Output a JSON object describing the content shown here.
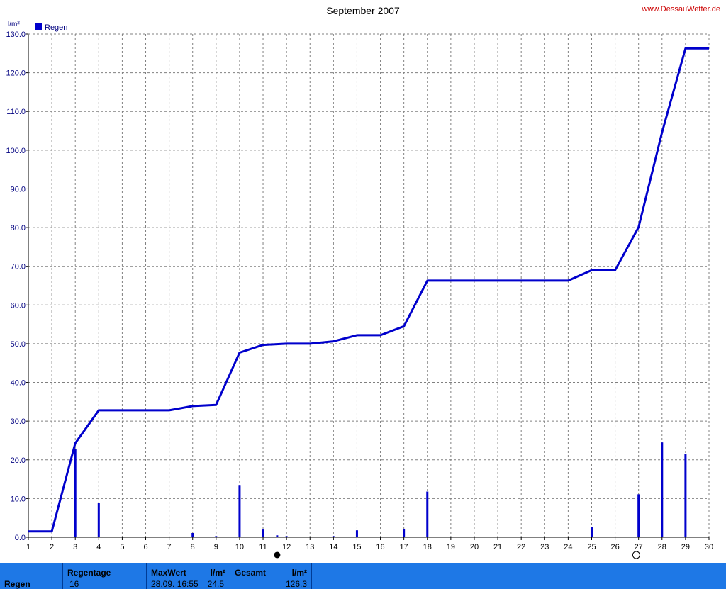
{
  "header": {
    "title": "September 2007",
    "source": "www.DessauWetter.de",
    "unit": "l/m²"
  },
  "legend": {
    "label": "Regen",
    "color": "#0000cc"
  },
  "moon_markers": [
    {
      "day": 11.6,
      "phase": "new-moon"
    },
    {
      "day": 26.9,
      "phase": "full-moon"
    }
  ],
  "chart_data": {
    "type": "bar+line",
    "title": "September 2007",
    "ylabel": "l/m²",
    "xlim": [
      1,
      30
    ],
    "ylim": [
      0,
      130
    ],
    "yticks": [
      "0.0",
      "10.0",
      "20.0",
      "30.0",
      "40.0",
      "50.0",
      "60.0",
      "70.0",
      "80.0",
      "90.0",
      "100.0",
      "110.0",
      "120.0",
      "130.0"
    ],
    "xticks": [
      "1",
      "2",
      "3",
      "4",
      "5",
      "6",
      "7",
      "8",
      "9",
      "10",
      "11",
      "12",
      "13",
      "14",
      "15",
      "16",
      "17",
      "18",
      "19",
      "20",
      "21",
      "22",
      "23",
      "24",
      "25",
      "26",
      "27",
      "28",
      "29",
      "30"
    ],
    "grid": true,
    "legend_position": "top-left",
    "daily_rain": [
      {
        "x": 3,
        "y": 22.8
      },
      {
        "x": 4,
        "y": 8.8
      },
      {
        "x": 8,
        "y": 1.1
      },
      {
        "x": 9,
        "y": 0.3
      },
      {
        "x": 10,
        "y": 13.5
      },
      {
        "x": 11,
        "y": 2.0
      },
      {
        "x": 11.6,
        "y": 0.5
      },
      {
        "x": 12,
        "y": 0.3
      },
      {
        "x": 14,
        "y": 0.3
      },
      {
        "x": 15,
        "y": 1.8
      },
      {
        "x": 17,
        "y": 2.2
      },
      {
        "x": 18,
        "y": 11.8
      },
      {
        "x": 25,
        "y": 2.7
      },
      {
        "x": 27,
        "y": 11.1
      },
      {
        "x": 28,
        "y": 24.5
      },
      {
        "x": 29,
        "y": 21.5
      }
    ],
    "cumulative": [
      {
        "x": 1,
        "y": 1.5
      },
      {
        "x": 2,
        "y": 1.5
      },
      {
        "x": 3,
        "y": 24.3
      },
      {
        "x": 4,
        "y": 32.8
      },
      {
        "x": 5,
        "y": 32.8
      },
      {
        "x": 6,
        "y": 32.8
      },
      {
        "x": 7,
        "y": 32.8
      },
      {
        "x": 8,
        "y": 33.9
      },
      {
        "x": 9,
        "y": 34.2
      },
      {
        "x": 10,
        "y": 47.7
      },
      {
        "x": 11,
        "y": 49.7
      },
      {
        "x": 12,
        "y": 50.0
      },
      {
        "x": 13,
        "y": 50.0
      },
      {
        "x": 14,
        "y": 50.6
      },
      {
        "x": 15,
        "y": 52.2
      },
      {
        "x": 16,
        "y": 52.2
      },
      {
        "x": 17,
        "y": 54.5
      },
      {
        "x": 18,
        "y": 66.3
      },
      {
        "x": 19,
        "y": 66.3
      },
      {
        "x": 20,
        "y": 66.3
      },
      {
        "x": 21,
        "y": 66.3
      },
      {
        "x": 22,
        "y": 66.3
      },
      {
        "x": 23,
        "y": 66.3
      },
      {
        "x": 24,
        "y": 66.3
      },
      {
        "x": 25,
        "y": 69.0
      },
      {
        "x": 26,
        "y": 69.0
      },
      {
        "x": 27,
        "y": 80.1
      },
      {
        "x": 28,
        "y": 104.6
      },
      {
        "x": 29,
        "y": 126.3
      },
      {
        "x": 30,
        "y": 126.3
      }
    ],
    "series": [
      {
        "name": "Regen",
        "color": "#0000cc"
      }
    ]
  },
  "summary": {
    "row_label": "Regen",
    "regentage_label": "Regentage",
    "regentage_value": "16",
    "maxwert_label": "MaxWert",
    "maxwert_unit": "l/m²",
    "maxwert_date": "28.09. 16:55",
    "maxwert_value": "24.5",
    "gesamt_label": "Gesamt",
    "gesamt_unit": "l/m²",
    "gesamt_value": "126.3"
  }
}
